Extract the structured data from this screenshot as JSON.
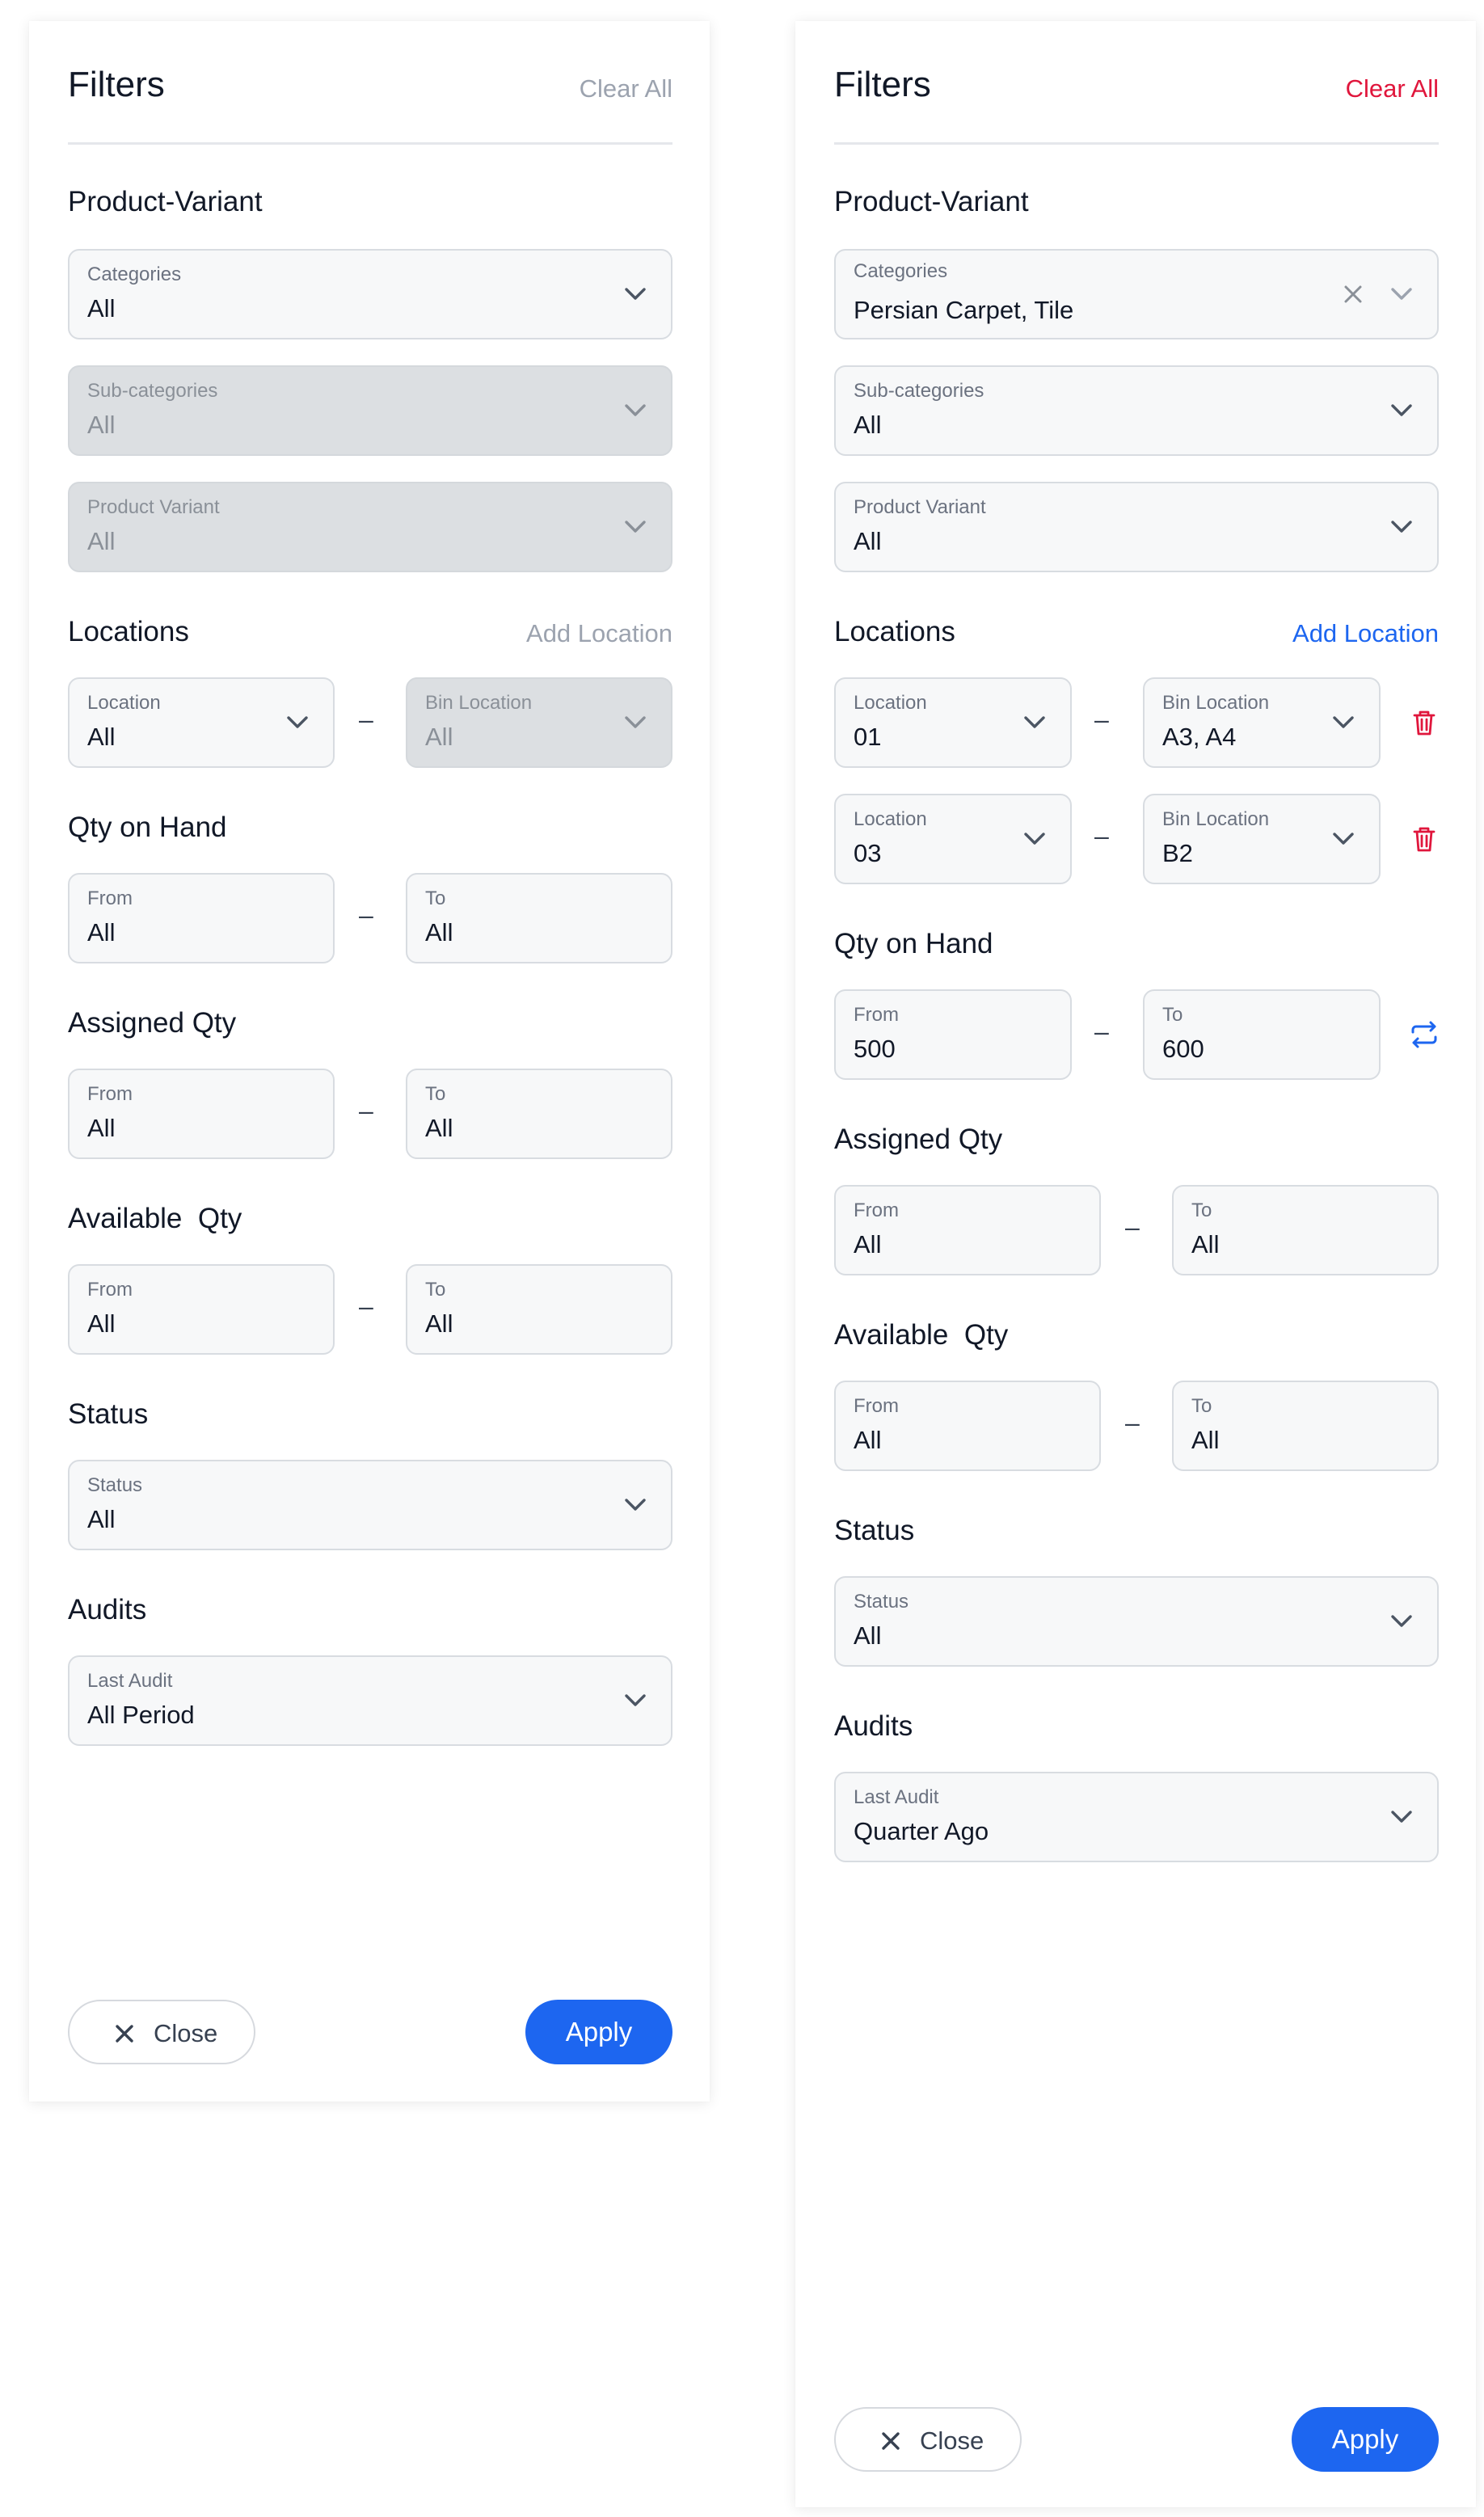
{
  "colors": {
    "accent_blue": "#1d66f0",
    "danger_red": "#e0163c",
    "muted_text": "#9ca3af",
    "disabled_field": "#dcdfe2"
  },
  "panels": [
    {
      "title": "Filters",
      "clear_all": "Clear All",
      "clear_all_state": "disabled",
      "product_variant": {
        "heading": "Product-Variant",
        "categories": {
          "label": "Categories",
          "value": "All"
        },
        "sub_categories": {
          "label": "Sub-categories",
          "value": "All",
          "state": "disabled"
        },
        "product_variant": {
          "label": "Product Variant",
          "value": "All",
          "state": "disabled"
        }
      },
      "locations": {
        "heading": "Locations",
        "add_location": "Add Location",
        "rows": [
          {
            "location_label": "Location",
            "location_value": "All",
            "bin_label": "Bin Location",
            "bin_value": "All",
            "bin_state": "disabled"
          }
        ]
      },
      "qty_on_hand": {
        "heading": "Qty on Hand",
        "from_label": "From",
        "from_value": "All",
        "to_label": "To",
        "to_value": "All"
      },
      "assigned_qty": {
        "heading": "Assigned Qty",
        "from_label": "From",
        "from_value": "All",
        "to_label": "To",
        "to_value": "All"
      },
      "available_qty": {
        "heading": "Available  Qty",
        "from_label": "From",
        "from_value": "All",
        "to_label": "To",
        "to_value": "All"
      },
      "status": {
        "heading": "Status",
        "label": "Status",
        "value": "All"
      },
      "audits": {
        "heading": "Audits",
        "label": "Last Audit",
        "value": "All Period"
      },
      "footer": {
        "close": "Close",
        "apply": "Apply"
      }
    },
    {
      "title": "Filters",
      "clear_all": "Clear All",
      "clear_all_state": "active",
      "product_variant": {
        "heading": "Product-Variant",
        "categories": {
          "label": "Categories",
          "value": "Persian Carpet, Tile"
        },
        "sub_categories": {
          "label": "Sub-categories",
          "value": "All"
        },
        "product_variant": {
          "label": "Product Variant",
          "value": "All"
        }
      },
      "locations": {
        "heading": "Locations",
        "add_location": "Add Location",
        "rows": [
          {
            "location_label": "Location",
            "location_value": "01",
            "bin_label": "Bin Location",
            "bin_value": "A3, A4",
            "action_icon": "trash-icon"
          },
          {
            "location_label": "Location",
            "location_value": "03",
            "bin_label": "Bin Location",
            "bin_value": "B2",
            "action_icon": "trash-icon"
          }
        ]
      },
      "qty_on_hand": {
        "heading": "Qty on Hand",
        "from_label": "From",
        "from_value": "500",
        "to_label": "To",
        "to_value": "600",
        "action_icon": "swap-arrows-icon"
      },
      "assigned_qty": {
        "heading": "Assigned Qty",
        "from_label": "From",
        "from_value": "All",
        "to_label": "To",
        "to_value": "All"
      },
      "available_qty": {
        "heading": "Available  Qty",
        "from_label": "From",
        "from_value": "All",
        "to_label": "To",
        "to_value": "All"
      },
      "status": {
        "heading": "Status",
        "label": "Status",
        "value": "All"
      },
      "audits": {
        "heading": "Audits",
        "label": "Last Audit",
        "value": "Quarter Ago"
      },
      "footer": {
        "close": "Close",
        "apply": "Apply"
      }
    }
  ]
}
